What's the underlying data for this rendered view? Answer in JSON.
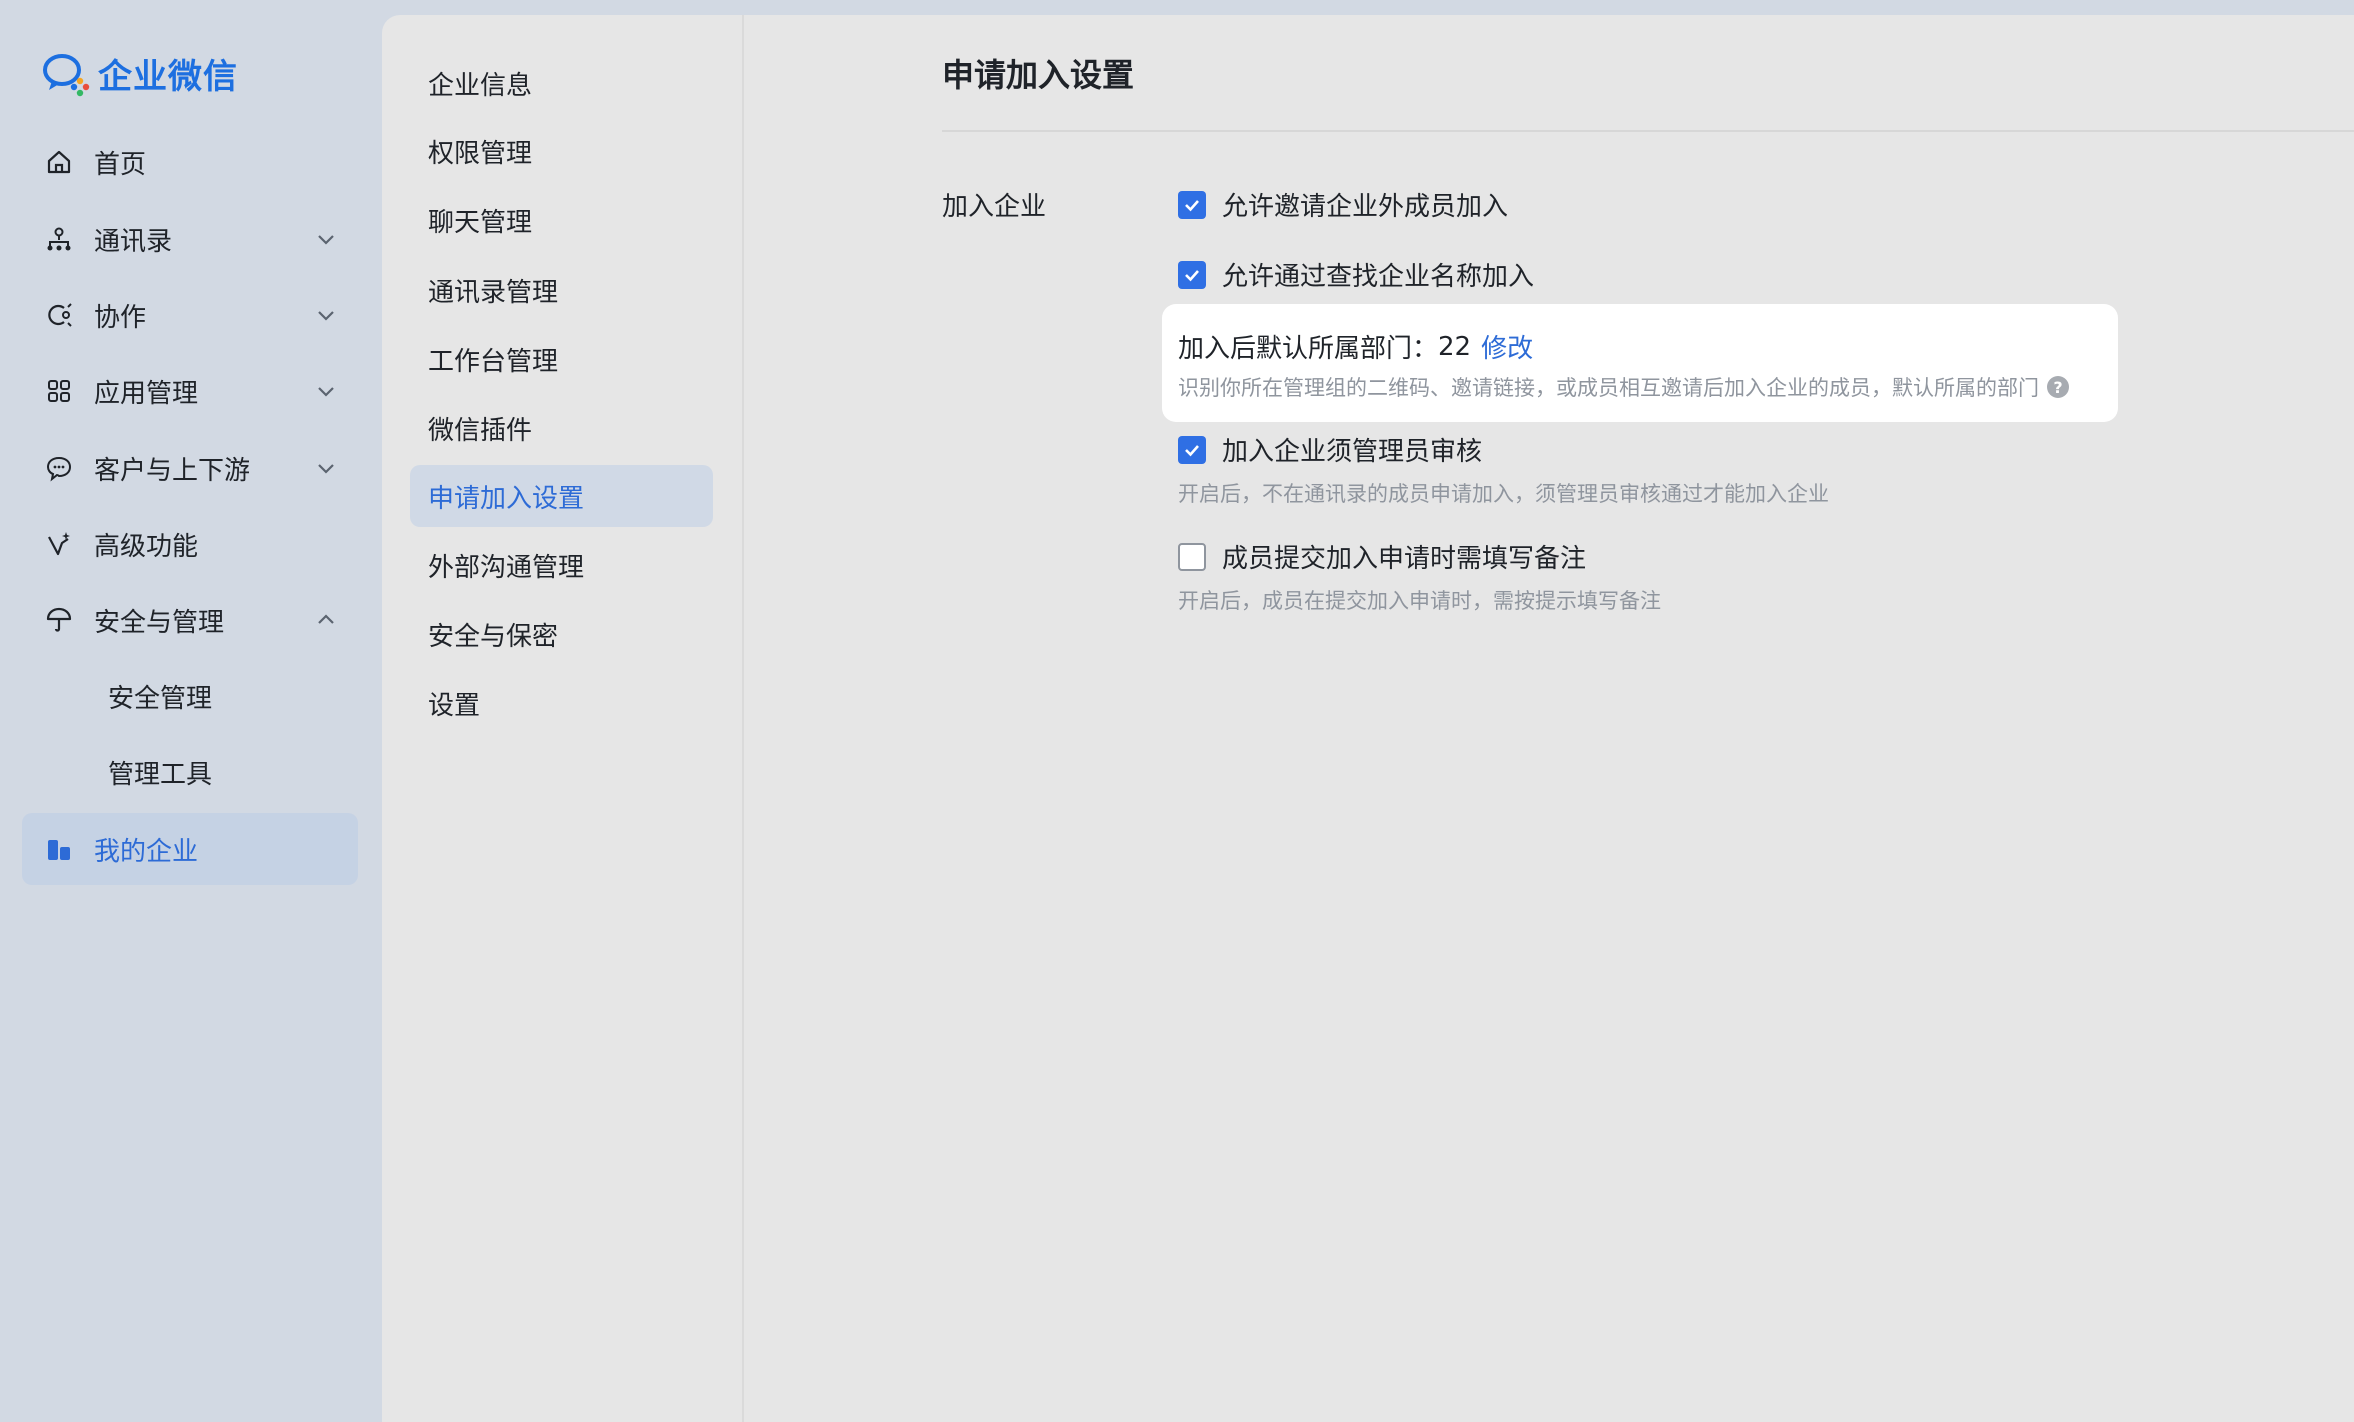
{
  "brand": {
    "name": "企业微信"
  },
  "sidebar": {
    "items": [
      {
        "label": "首页",
        "icon": "home-icon"
      },
      {
        "label": "通讯录",
        "icon": "org-chart-icon",
        "chevron": "down"
      },
      {
        "label": "协作",
        "icon": "collaboration-icon",
        "chevron": "down"
      },
      {
        "label": "应用管理",
        "icon": "apps-grid-icon",
        "chevron": "down"
      },
      {
        "label": "客户与上下游",
        "icon": "chat-bubble-icon",
        "chevron": "down"
      },
      {
        "label": "高级功能",
        "icon": "sparkle-icon"
      },
      {
        "label": "安全与管理",
        "icon": "umbrella-icon",
        "chevron": "up"
      },
      {
        "label": "安全管理"
      },
      {
        "label": "管理工具"
      },
      {
        "label": "我的企业",
        "icon": "building-icon",
        "active": true
      }
    ]
  },
  "subnav": {
    "items": [
      "企业信息",
      "权限管理",
      "聊天管理",
      "通讯录管理",
      "工作台管理",
      "微信插件",
      "申请加入设置",
      "外部沟通管理",
      "安全与保密",
      "设置"
    ],
    "active_index": 6
  },
  "main": {
    "title": "申请加入设置",
    "section_label": "加入企业",
    "options": [
      {
        "label": "允许邀请企业外成员加入",
        "checked": true
      },
      {
        "label": "允许通过查找企业名称加入",
        "checked": true
      },
      {
        "label": "加入企业须管理员审核",
        "checked": true,
        "desc": "开启后，不在通讯录的成员申请加入，须管理员审核通过才能加入企业"
      },
      {
        "label": "成员提交加入申请时需填写备注",
        "checked": false,
        "desc": "开启后，成员在提交加入申请时，需按提示填写备注"
      }
    ],
    "dept_card": {
      "label": "加入后默认所属部门：",
      "value": "22",
      "modify": "修改",
      "desc": "识别你所在管理组的二维码、邀请链接，或成员相互邀请后加入企业的成员，默认所属的部门",
      "help": "?"
    }
  },
  "colors": {
    "accent": "#2f6fe4",
    "link": "#2d6bd6",
    "brand": "#1d6fe0",
    "sidebar_bg": "#d2d9e3",
    "content_bg": "#e6e6e6"
  }
}
